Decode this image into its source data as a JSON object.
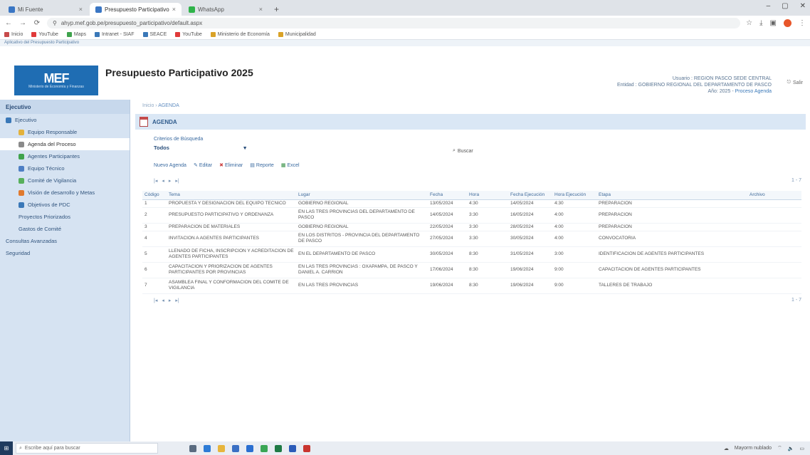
{
  "browser": {
    "tabs": [
      {
        "label": "Mi Fuente",
        "active": false
      },
      {
        "label": "Presupuesto Participativo",
        "active": true
      },
      {
        "label": "WhatsApp",
        "active": false
      }
    ],
    "url": "ahyp.mef.gob.pe/presupuesto_participativo/default.aspx",
    "bookmarks": [
      "Inicio",
      "YouTube",
      "Maps",
      "Intranet - SIAF",
      "SEACE",
      "YouTube",
      "Ministerio de Economía",
      "Municipalidad"
    ]
  },
  "app": {
    "system_label": "Aplicativo del Presupuesto Participativo",
    "title": "Presupuesto Participativo 2025",
    "logo_mark": "MEF",
    "logo_sub": "Ministerio de Economía y Finanzas",
    "user": {
      "line1": "Usuario : REGION PASCO SEDE CENTRAL",
      "line2": "Entidad : GOBIERNO REGIONAL DEL DEPARTAMENTO DE PASCO",
      "line3": "Año: 2025",
      "process": "Proceso Agenda"
    },
    "logout_label": "Salir"
  },
  "sidebar": {
    "header": "Ejecutivo",
    "items": [
      {
        "label": "Ejecutivo",
        "level": "top",
        "color": "#3a78b8",
        "selected": false
      },
      {
        "label": "Equipo Responsable",
        "level": "sub",
        "color": "#e3b23c",
        "selected": false
      },
      {
        "label": "Agenda del Proceso",
        "level": "sub",
        "color": "#8a8a8a",
        "selected": true
      },
      {
        "label": "Agentes Participantes",
        "level": "sub",
        "color": "#3fa34d",
        "selected": false
      },
      {
        "label": "Equipo Técnico",
        "level": "sub",
        "color": "#4e7fc4",
        "selected": false
      },
      {
        "label": "Comité de Vigilancia",
        "level": "sub",
        "color": "#58b05c",
        "selected": false
      },
      {
        "label": "Visión de desarrollo y Metas",
        "level": "sub",
        "color": "#e07a2f",
        "selected": false
      },
      {
        "label": "Objetivos de PDC",
        "level": "sub",
        "color": "#3a78b8",
        "selected": false
      },
      {
        "label": "Proyectos Priorizados",
        "level": "sub",
        "color": "",
        "selected": false
      },
      {
        "label": "Gastos de Comité",
        "level": "sub",
        "color": "",
        "selected": false
      },
      {
        "label": "Consultas Avanzadas",
        "level": "top",
        "color": "",
        "selected": false
      },
      {
        "label": "Seguridad",
        "level": "top",
        "color": "",
        "selected": false
      }
    ]
  },
  "main": {
    "breadcrumb_prefix": "Inicio",
    "breadcrumb_current": "AGENDA",
    "panel_title": "AGENDA",
    "filter_label": "Criterios de Búsqueda",
    "filter_value": "Todos",
    "search_label": "Buscar",
    "toolbar": {
      "new_label": "Nuevo Agenda",
      "edit_label": "Editar",
      "delete_label": "Eliminar",
      "report_label": "Reporte",
      "excel_label": "Excel"
    },
    "page_count": "1 - 7",
    "columns": [
      "Código",
      "Tema",
      "Lugar",
      "Fecha",
      "Hora",
      "Fecha Ejecución",
      "Hora Ejecución",
      "Etapa",
      "Archivo"
    ],
    "rows": [
      [
        "1",
        "PROPUESTA Y DESIGNACION DEL EQUIPO TECNICO",
        "GOBIERNO REGIONAL",
        "13/05/2024",
        "4:30",
        "14/05/2024",
        "4:30",
        "PREPARACION",
        ""
      ],
      [
        "2",
        "PRESUPUESTO PARTICIPATIVO Y ORDENANZA",
        "EN LAS TRES PROVINCIAS DEL DEPARTAMENTO DE PASCO",
        "14/05/2024",
        "3:30",
        "16/05/2024",
        "4:00",
        "PREPARACION",
        ""
      ],
      [
        "3",
        "PREPARACION DE MATERIALES",
        "GOBIERNO REGIONAL",
        "22/05/2024",
        "3:30",
        "28/05/2024",
        "4:00",
        "PREPARACION",
        ""
      ],
      [
        "4",
        "INVITACION A AGENTES PARTICIPANTES",
        "EN LOS DISTRITOS - PROVINCIA DEL DEPARTAMENTO DE PASCO",
        "27/05/2024",
        "3:30",
        "30/05/2024",
        "4:00",
        "CONVOCATORIA",
        ""
      ],
      [
        "5",
        "LLENADO DE FICHA, INSCRIPCION Y ACREDITACION DE AGENTES PARTICIPANTES",
        "EN EL DEPARTAMENTO DE PASCO",
        "30/05/2024",
        "8:30",
        "31/05/2024",
        "3:00",
        "IDENTIFICACION DE AGENTES PARTICIPANTES",
        ""
      ],
      [
        "6",
        "CAPACITACION Y PRIORIZACION DE AGENTES PARTICIPANTES POR PROVINCIAS",
        "EN LAS TRES PROVINCIAS : OXAPAMPA, DE PASCO Y DANIEL A. CARRION",
        "17/06/2024",
        "8:30",
        "19/06/2024",
        "9:00",
        "CAPACITACION DE AGENTES PARTICIPANTES",
        ""
      ],
      [
        "7",
        "ASAMBLEA FINAL Y CONFORMACION DEL COMITE DE VIGILANCIA",
        "EN LAS TRES PROVINCIAS",
        "19/06/2024",
        "8:30",
        "19/06/2024",
        "9:00",
        "TALLERES DE TRABAJO",
        ""
      ]
    ]
  },
  "taskbar": {
    "search_placeholder": "Escribe aquí para buscar",
    "tray_text": "Mayorm nublado"
  }
}
